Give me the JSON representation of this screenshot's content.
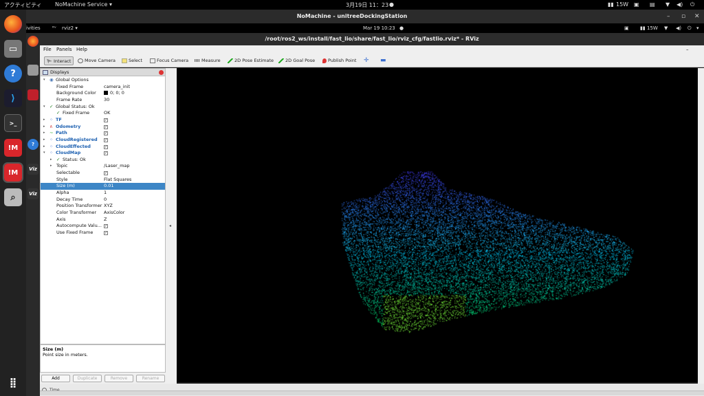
{
  "outer_bar": {
    "activities": "アクティビティ",
    "app": "NoMachine Service ▾",
    "clock": "3月19日  11：23",
    "power": "15W"
  },
  "nomachine": {
    "title": "NoMachine - unitreeDockingStation"
  },
  "inner_bar": {
    "activities": "ivities",
    "app": "rviz2 ▾",
    "clock": "Mar 19  10:23",
    "power": "15W"
  },
  "rviz": {
    "title": "/root/ros2_ws/install/fast_lio/share/fast_lio/rviz_cfg/fastlio.rviz* - RViz",
    "menu": [
      "File",
      "Panels",
      "Help"
    ],
    "tools": [
      {
        "label": "Interact",
        "icon": "interact-icon"
      },
      {
        "label": "Move Camera",
        "icon": "move-camera-icon"
      },
      {
        "label": "Select",
        "icon": "select-icon"
      },
      {
        "label": "Focus Camera",
        "icon": "focus-camera-icon"
      },
      {
        "label": "Measure",
        "icon": "measure-icon"
      },
      {
        "label": "2D Pose Estimate",
        "icon": "pose-estimate-icon"
      },
      {
        "label": "2D Goal Pose",
        "icon": "goal-pose-icon"
      },
      {
        "label": "Publish Point",
        "icon": "publish-point-icon"
      }
    ],
    "displays_title": "Displays",
    "rows": [
      {
        "k": "Global Options",
        "v": "",
        "indent": 1,
        "expander": "▾",
        "icon": "globe-icon"
      },
      {
        "k": "Fixed Frame",
        "v": "camera_init",
        "indent": 2
      },
      {
        "k": "Background Color",
        "v": "0; 0; 0",
        "indent": 2,
        "swatch": true
      },
      {
        "k": "Frame Rate",
        "v": "30",
        "indent": 2
      },
      {
        "k": "Global Status: Ok",
        "v": "",
        "indent": 1,
        "expander": "▾",
        "icon": "check-icon"
      },
      {
        "k": "Fixed Frame",
        "v": "OK",
        "indent": 2,
        "icon": "check-icon"
      },
      {
        "k": "TF",
        "v": "✓",
        "indent": 1,
        "expander": "▸",
        "blue": true,
        "check": true
      },
      {
        "k": "Odometry",
        "v": "✓",
        "indent": 1,
        "expander": "▸",
        "blue": true,
        "check": true
      },
      {
        "k": "Path",
        "v": "✓",
        "indent": 1,
        "expander": "▸",
        "blue": true,
        "check": true
      },
      {
        "k": "CloudRegistered",
        "v": "✓",
        "indent": 1,
        "expander": "▸",
        "blue": true,
        "check": true
      },
      {
        "k": "CloudEffected",
        "v": "✓",
        "indent": 1,
        "expander": "▸",
        "blue": true,
        "check": true
      },
      {
        "k": "CloudMap",
        "v": "✓",
        "indent": 1,
        "expander": "▾",
        "blue": true,
        "check": true
      },
      {
        "k": "Status: Ok",
        "v": "",
        "indent": 2,
        "expander": "▸",
        "icon": "check-icon"
      },
      {
        "k": "Topic",
        "v": "/Laser_map",
        "indent": 2,
        "expander": "▸"
      },
      {
        "k": "Selectable",
        "v": "✓",
        "indent": 2,
        "check": true
      },
      {
        "k": "Style",
        "v": "Flat Squares",
        "indent": 2
      },
      {
        "k": "Size (m)",
        "v": "0.01",
        "indent": 2,
        "selected": true
      },
      {
        "k": "Alpha",
        "v": "1",
        "indent": 2
      },
      {
        "k": "Decay Time",
        "v": "0",
        "indent": 2
      },
      {
        "k": "Position Transformer",
        "v": "XYZ",
        "indent": 2
      },
      {
        "k": "Color Transformer",
        "v": "AxisColor",
        "indent": 2
      },
      {
        "k": "Axis",
        "v": "Z",
        "indent": 2
      },
      {
        "k": "Autocompute Valu...",
        "v": "✓",
        "indent": 2,
        "check": true
      },
      {
        "k": "Use Fixed Frame",
        "v": "✓",
        "indent": 2,
        "check": true
      }
    ],
    "desc_title": "Size (m)",
    "desc_text": "Point size in meters.",
    "buttons": [
      {
        "label": "Add",
        "enabled": true
      },
      {
        "label": "Duplicate",
        "enabled": false
      },
      {
        "label": "Remove",
        "enabled": false
      },
      {
        "label": "Rename",
        "enabled": false
      }
    ],
    "bottom_label": "Time"
  }
}
